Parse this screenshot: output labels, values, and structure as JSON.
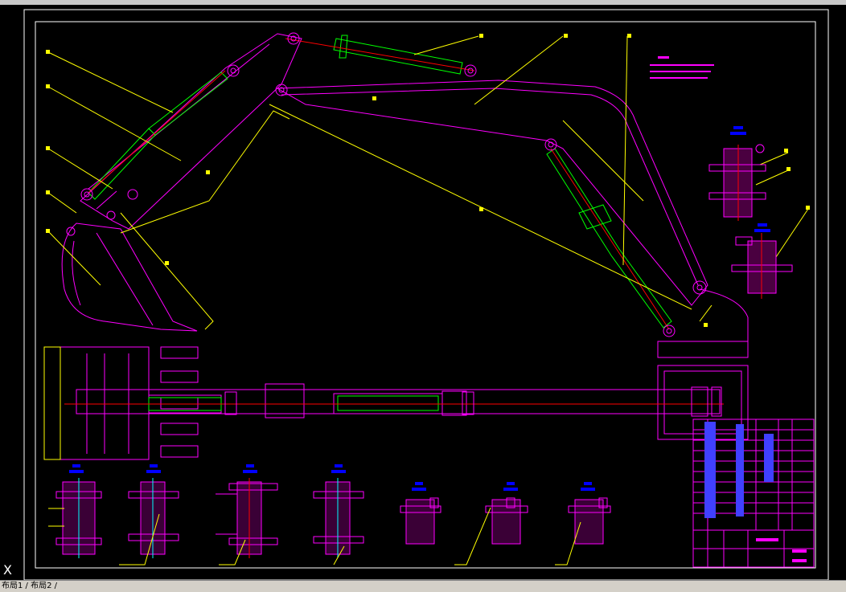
{
  "statusbar": {
    "layout_tabs": "布局1 / 布局2 /"
  },
  "colors": {
    "background": "#000000",
    "frame": "#ffffff",
    "outline": "#ff00ff",
    "leader": "#ffff00",
    "cylinder": "#00ff00",
    "centerline": "#ff0000",
    "section_label": "#0000ff"
  },
  "icons": {
    "ucs": "ucs-axis-icon",
    "ucs_glyph": "X"
  }
}
